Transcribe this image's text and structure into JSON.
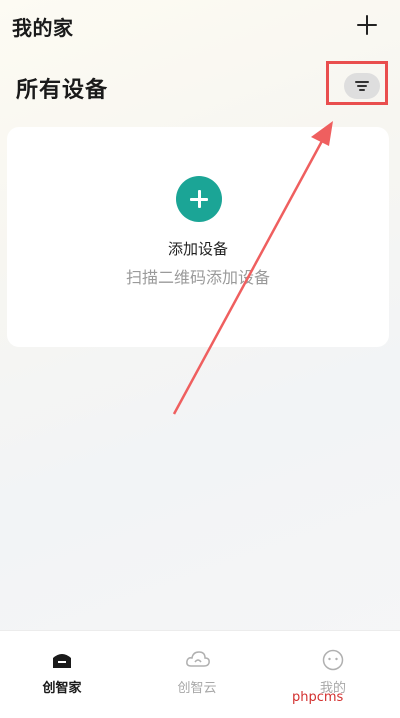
{
  "header": {
    "title": "我的家"
  },
  "section": {
    "title": "所有设备"
  },
  "empty_card": {
    "add_label": "添加设备",
    "hint": "扫描二维码添加设备"
  },
  "tabs": [
    {
      "label": "创智家",
      "icon": "home-icon",
      "active": true
    },
    {
      "label": "创智云",
      "icon": "cloud-icon",
      "active": false
    },
    {
      "label": "我的",
      "icon": "face-icon",
      "active": false
    }
  ],
  "watermark": "phpcms",
  "colors": {
    "accent": "#1ba596",
    "annotation": "#e94e4e",
    "inactive": "#a8a8a8"
  }
}
